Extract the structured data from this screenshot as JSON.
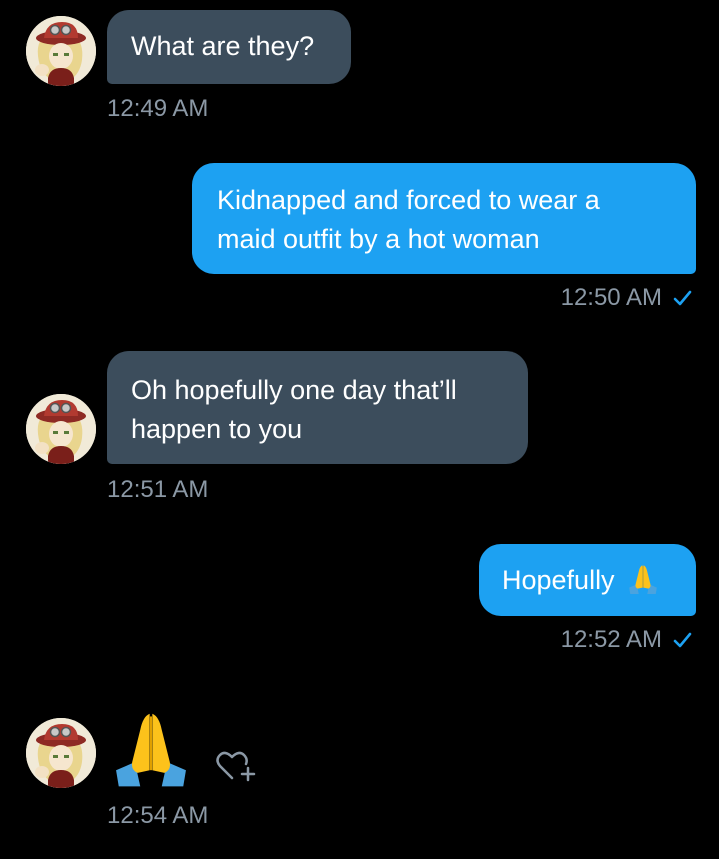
{
  "conversation": {
    "messages": [
      {
        "direction": "incoming",
        "text": "What are they?",
        "time": "12:49 AM"
      },
      {
        "direction": "outgoing",
        "text_line1": "Kidnapped and forced to wear a",
        "text_line2": "maid outfit by a hot woman",
        "time": "12:50 AM"
      },
      {
        "direction": "incoming",
        "text_line1": "Oh hopefully one day that’ll",
        "text_line2": "happen to you",
        "time": "12:51 AM"
      },
      {
        "direction": "outgoing",
        "text": "Hopefully",
        "emoji": "folded-hands",
        "time": "12:52 AM"
      },
      {
        "direction": "incoming",
        "emoji": "folded-hands",
        "time": "12:54 AM"
      }
    ]
  },
  "colors": {
    "background": "#000000",
    "incoming_bubble": "#3c4d5c",
    "outgoing_bubble": "#1da1f2",
    "timestamp": "#8b98a5",
    "read_check": "#1da1f2"
  },
  "icons": {
    "read_receipt": "check-icon",
    "react": "add-reaction-heart-icon",
    "avatar": "anime-avatar"
  }
}
